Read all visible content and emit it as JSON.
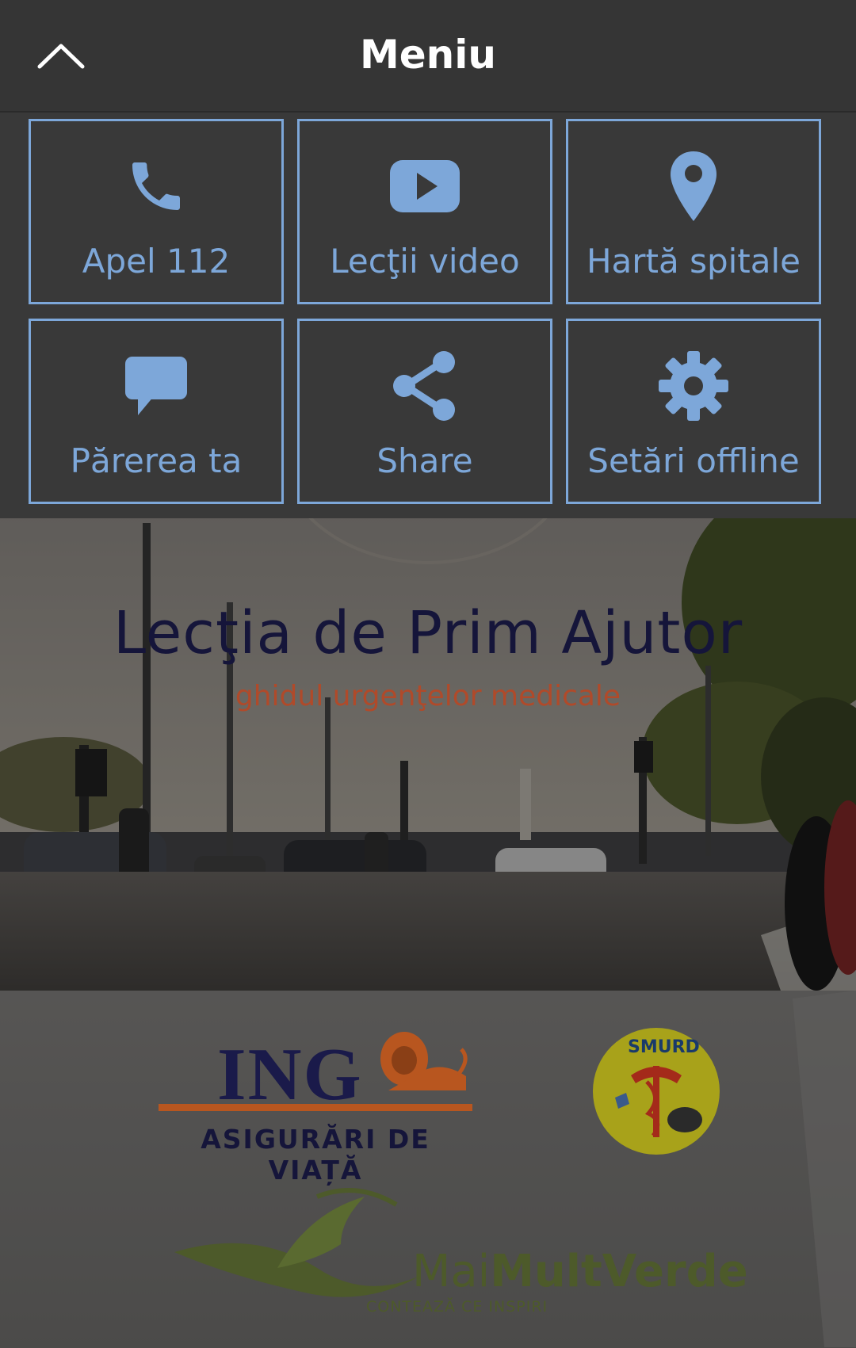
{
  "header": {
    "title": "Meniu"
  },
  "menu": {
    "items": [
      {
        "label": "Apel 112",
        "icon": "phone-icon"
      },
      {
        "label": "Lecţii video",
        "icon": "youtube-play-icon"
      },
      {
        "label": "Hartă spitale",
        "icon": "map-marker-icon"
      },
      {
        "label": "Părerea ta",
        "icon": "speech-bubble-icon"
      },
      {
        "label": "Share",
        "icon": "share-icon"
      },
      {
        "label": "Setări offline",
        "icon": "gear-icon"
      }
    ]
  },
  "hero": {
    "title": "Lecţia de Prim Ajutor",
    "subtitle": "ghidul urgenţelor medicale"
  },
  "sponsors": {
    "ing_name": "ING",
    "ing_tagline": "ASIGURĂRI DE VIAȚĂ",
    "smurd": "SMURD",
    "mmv_light": "Mai",
    "mmv_bold": "MultVerde",
    "mmv_tagline": "CONTEAZĂ CE INSPIRI"
  },
  "colors": {
    "accent": "#7da7d9",
    "topbar": "#353535",
    "panel": "#393939",
    "hero_title": "#15153a",
    "hero_subtitle": "#b04a2a"
  }
}
